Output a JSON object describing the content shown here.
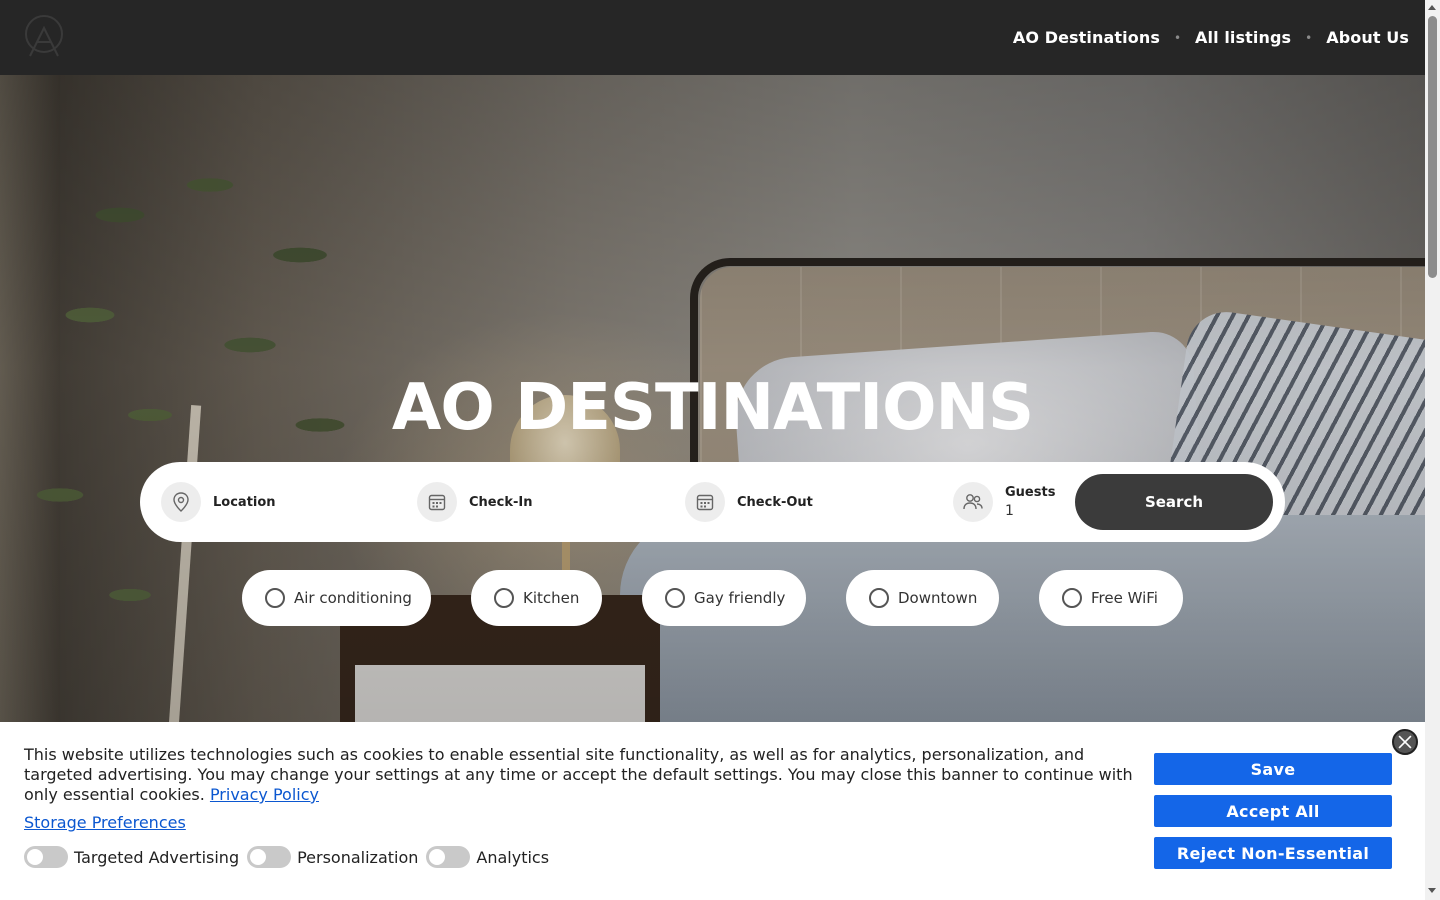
{
  "header": {
    "logo_icon": "ao-mountain-logo-icon",
    "nav": [
      {
        "label": "AO Destinations"
      },
      {
        "label": "All listings"
      },
      {
        "label": "About Us"
      }
    ],
    "separator": "•"
  },
  "hero": {
    "title": "AO DESTINATIONS",
    "search": {
      "location_label": "Location",
      "checkin_label": "Check-In",
      "checkout_label": "Check-Out",
      "guests_label": "Guests",
      "guests_value": "1",
      "search_button": "Search",
      "icons": {
        "location": "map-pin-icon",
        "checkin": "calendar-icon",
        "checkout": "calendar-icon",
        "guests": "users-icon"
      }
    },
    "filters": [
      {
        "label": "Air conditioning"
      },
      {
        "label": "Kitchen"
      },
      {
        "label": "Gay friendly"
      },
      {
        "label": "Downtown"
      },
      {
        "label": "Free WiFi"
      }
    ]
  },
  "cookie_banner": {
    "text": "This website utilizes technologies such as cookies to enable essential site functionality, as well as for analytics, personalization, and targeted advertising. You may change your settings at any time or accept the default settings. You may close this banner to continue with only essential cookies.",
    "privacy_link": "Privacy Policy",
    "storage_link": "Storage Preferences",
    "toggles": [
      {
        "label": "Targeted Advertising",
        "on": false
      },
      {
        "label": "Personalization",
        "on": false
      },
      {
        "label": "Analytics",
        "on": false
      }
    ],
    "buttons": {
      "save": "Save",
      "accept": "Accept All",
      "reject": "Reject Non-Essential"
    },
    "accent_color": "#1466e8"
  }
}
